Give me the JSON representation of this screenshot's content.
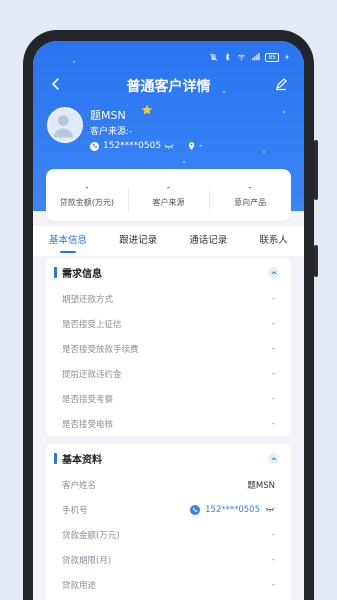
{
  "status_bar": {
    "battery": "85"
  },
  "header": {
    "title": "普通客户详情"
  },
  "customer": {
    "name": "题MSN",
    "source_line": "客户来源:-",
    "phone": "152****0505",
    "location": "-"
  },
  "summary": [
    {
      "value": "-",
      "label": "贷款金额(万元)"
    },
    {
      "value": "-",
      "label": "客户来源"
    },
    {
      "value": "-",
      "label": "意向产品"
    }
  ],
  "tabs": [
    {
      "label": "基本信息",
      "active": true
    },
    {
      "label": "跟进记录",
      "active": false
    },
    {
      "label": "通话记录",
      "active": false
    },
    {
      "label": "联系人",
      "active": false
    }
  ],
  "demand": {
    "title": "需求信息",
    "rows": [
      {
        "label": "期望还款方式",
        "value": "-"
      },
      {
        "label": "是否接受上征信",
        "value": "-"
      },
      {
        "label": "是否接受放款手续费",
        "value": "-"
      },
      {
        "label": "提前还款违约金",
        "value": "-"
      },
      {
        "label": "是否接受考察",
        "value": "-"
      },
      {
        "label": "是否接受电核",
        "value": "-"
      }
    ]
  },
  "basic": {
    "title": "基本资料",
    "rows": [
      {
        "label": "客户姓名",
        "value": "题MSN"
      },
      {
        "label": "手机号",
        "value": "152****0505"
      },
      {
        "label": "贷款金额(万元)",
        "value": "-"
      },
      {
        "label": "贷款期限(月)",
        "value": "-"
      },
      {
        "label": "贷款用途",
        "value": "-"
      }
    ]
  },
  "colors": {
    "primary": "#2b73e9",
    "hero_top": "#2a74ee",
    "hero_bottom": "#3a86f6"
  }
}
